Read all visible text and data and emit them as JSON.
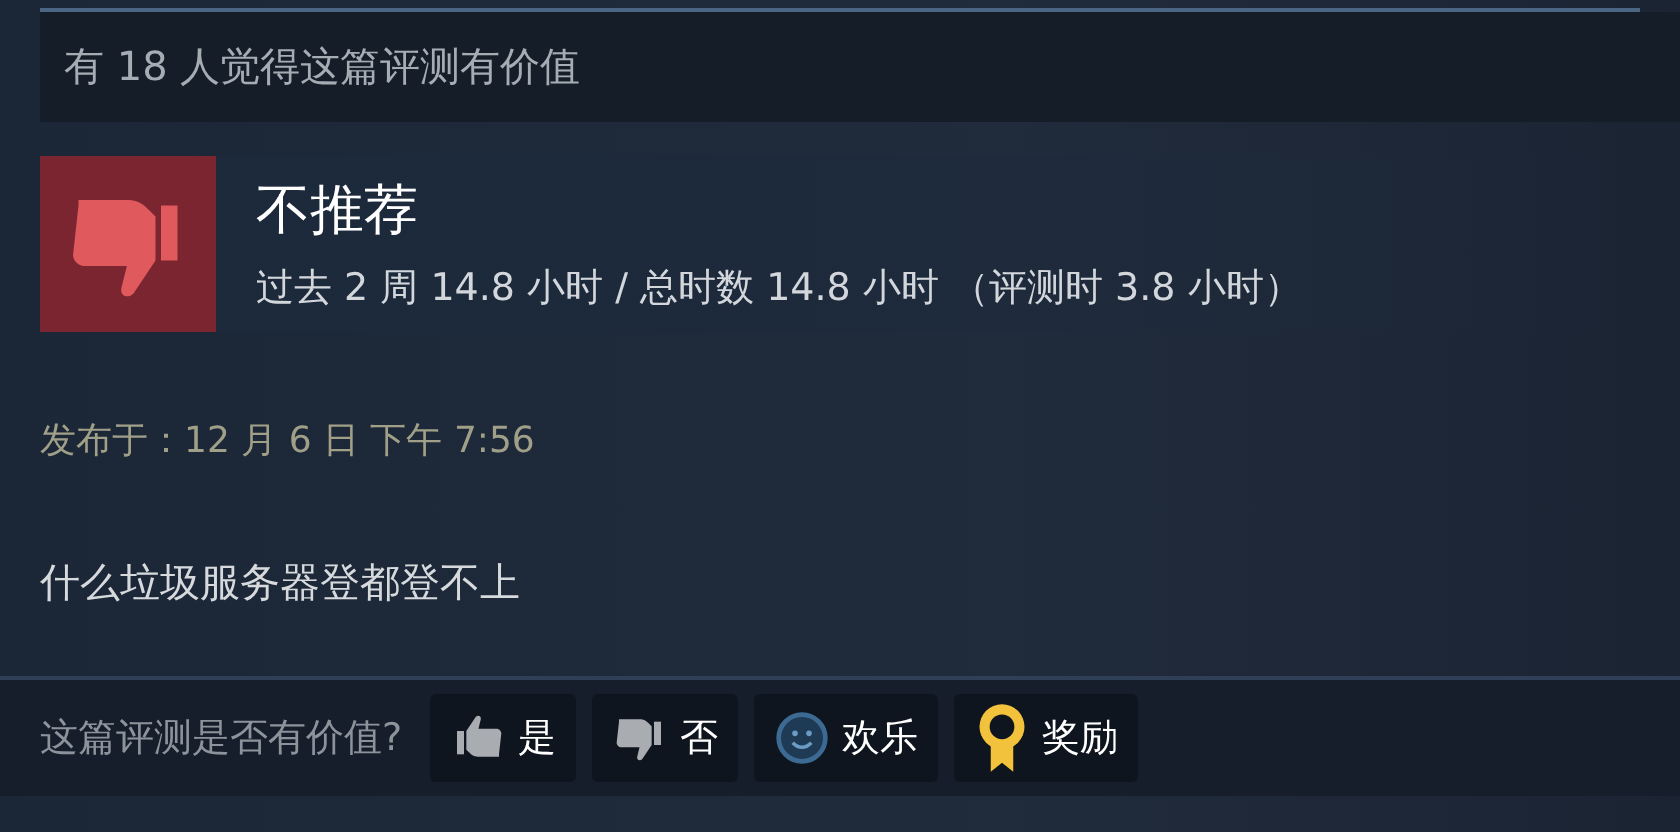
{
  "helpful_banner": "有 18 人觉得这篇评测有价值",
  "review": {
    "verdict": "不推荐",
    "recommended": false,
    "playtime": "过去 2 周 14.8 小时 / 总时数 14.8 小时 （评测时 3.8 小时）"
  },
  "posted": "发布于：12 月 6 日 下午 7:56",
  "body": "什么垃圾服务器登都登不上",
  "feedback": {
    "question": "这篇评测是否有价值?",
    "buttons": [
      {
        "kind": "up",
        "label": "是"
      },
      {
        "kind": "down",
        "label": "否"
      },
      {
        "kind": "funny",
        "label": "欢乐"
      },
      {
        "kind": "award",
        "label": "奖励"
      }
    ]
  }
}
